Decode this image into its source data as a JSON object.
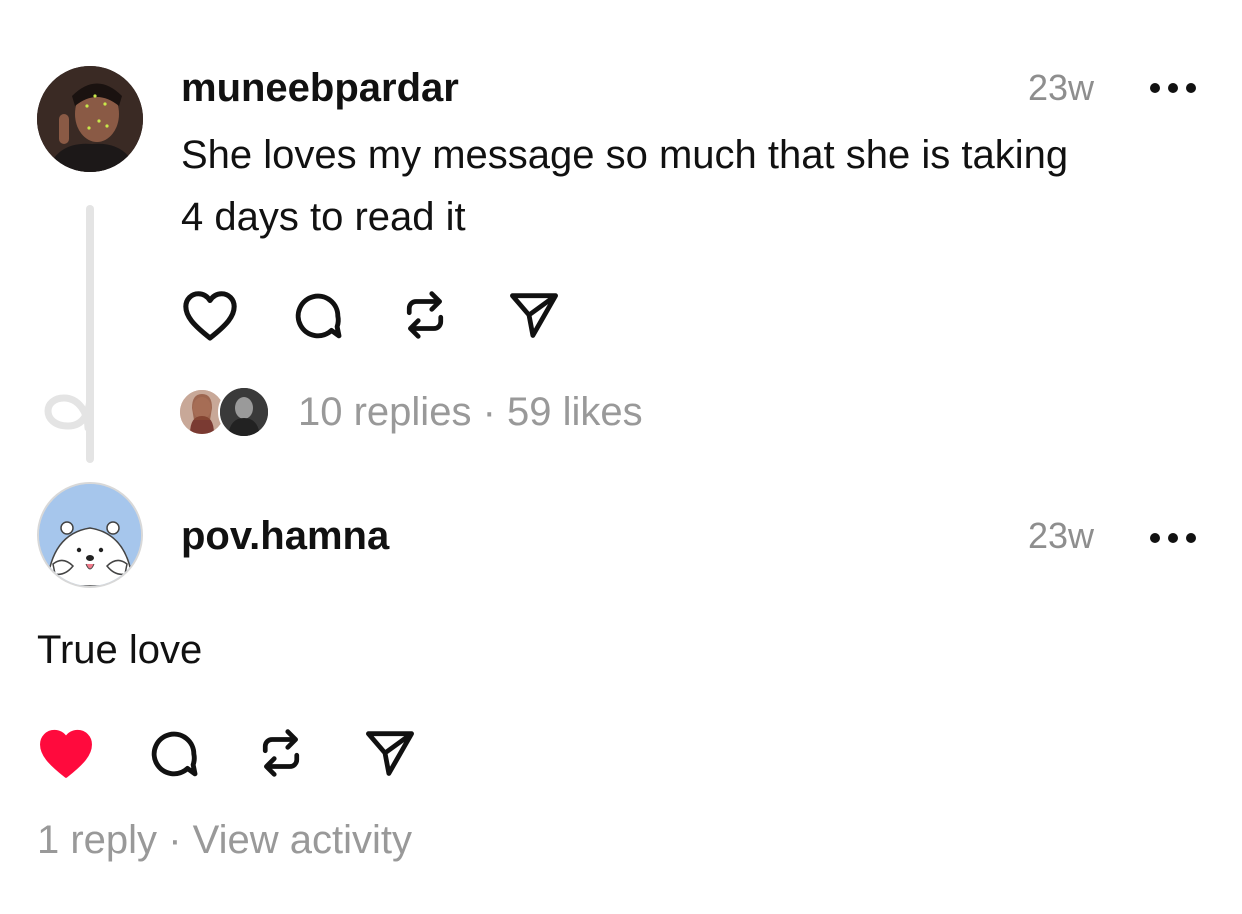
{
  "post": {
    "username": "muneebpardar",
    "time": "23w",
    "text_line1": "She loves my message so much that she is taking",
    "text_line2": "4 days to read it",
    "replies": "10 replies",
    "separator": "·",
    "likes": "59 likes",
    "icons": [
      "heart-icon",
      "comment-icon",
      "repost-icon",
      "share-icon",
      "more-icon"
    ]
  },
  "reply": {
    "username": "pov.hamna",
    "time": "23w",
    "text": "True love",
    "reply_count": "1 reply",
    "separator": "·",
    "view_activity": "View activity",
    "liked": true,
    "icons": [
      "heart-filled-icon",
      "comment-icon",
      "repost-icon",
      "share-icon",
      "more-icon"
    ]
  },
  "colors": {
    "liked_heart": "#ff0a3d",
    "secondary_text": "#999999",
    "thread_line": "#e4e4e4"
  }
}
